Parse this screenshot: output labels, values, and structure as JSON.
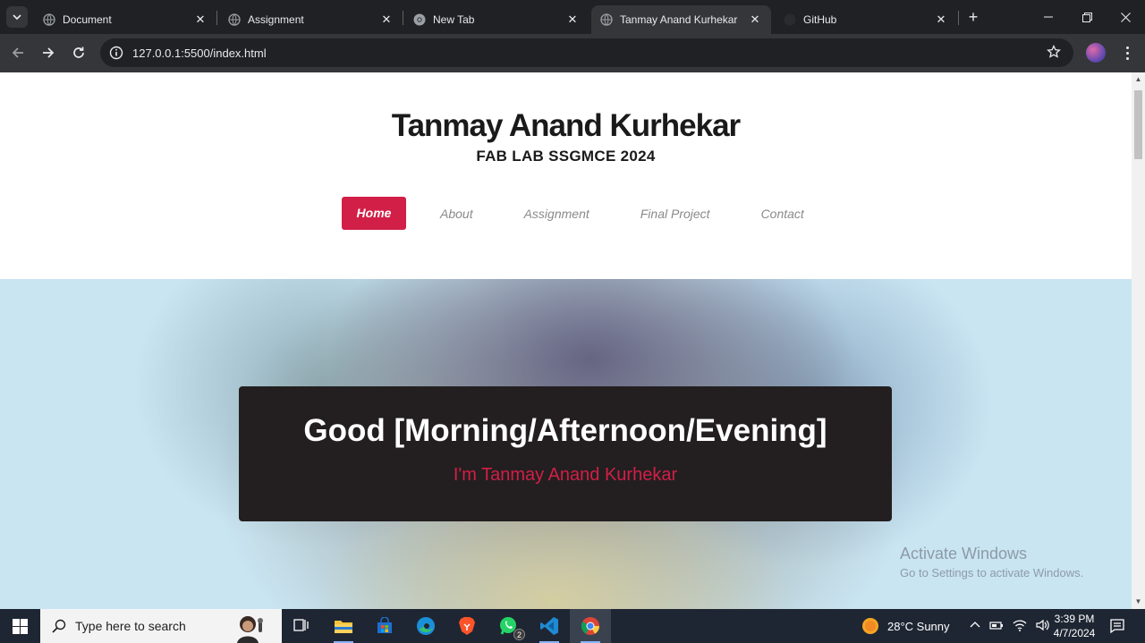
{
  "browser": {
    "tabs": [
      {
        "title": "Document",
        "icon": "globe-icon",
        "active": false
      },
      {
        "title": "Assignment",
        "icon": "globe-icon",
        "active": false
      },
      {
        "title": "New Tab",
        "icon": "chrome-icon",
        "active": false
      },
      {
        "title": "Tanmay Anand Kurhekar",
        "icon": "globe-icon",
        "active": true
      },
      {
        "title": "GitHub",
        "icon": "github-icon",
        "active": false
      }
    ],
    "url": "127.0.0.1:5500/index.html"
  },
  "site": {
    "title": "Tanmay Anand Kurhekar",
    "subtitle": "FAB LAB SSGMCE 2024",
    "nav": [
      "Home",
      "About",
      "Assignment",
      "Final Project",
      "Contact"
    ],
    "active_nav": "Home",
    "accent": "#d21f47"
  },
  "hero": {
    "greeting": "Good [Morning/Afternoon/Evening]",
    "intro": "I'm Tanmay Anand Kurhekar"
  },
  "watermark": {
    "line1": "Activate Windows",
    "line2": "Go to Settings to activate Windows."
  },
  "taskbar": {
    "search_placeholder": "Type here to search",
    "whatsapp_badge": "2",
    "weather": "28°C  Sunny",
    "time": "3:39 PM",
    "date": "4/7/2024"
  }
}
